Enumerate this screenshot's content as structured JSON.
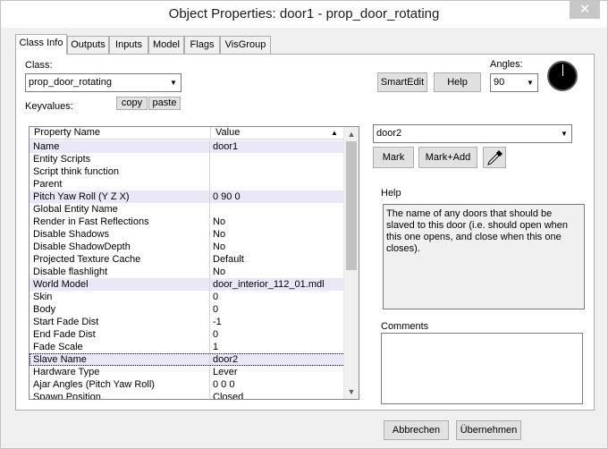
{
  "window": {
    "title": "Object Properties: door1 - prop_door_rotating",
    "close_glyph": "✕"
  },
  "tabs": [
    "Class Info",
    "Outputs",
    "Inputs",
    "Model",
    "Flags",
    "VisGroup"
  ],
  "class_section": {
    "class_label": "Class:",
    "class_value": "prop_door_rotating",
    "keyvalues_label": "Keyvalues:",
    "copy_label": "copy",
    "paste_label": "paste",
    "smartedit_label": "SmartEdit",
    "help_label": "Help",
    "angles_label": "Angles:",
    "angles_value": "90"
  },
  "grid": {
    "col_property": "Property Name",
    "col_value": "Value",
    "rows": [
      {
        "k": "Name",
        "v": "door1"
      },
      {
        "k": "Entity Scripts",
        "v": ""
      },
      {
        "k": "Script think function",
        "v": ""
      },
      {
        "k": "Parent",
        "v": ""
      },
      {
        "k": "Pitch Yaw Roll (Y Z X)",
        "v": "0 90 0"
      },
      {
        "k": "Global Entity Name",
        "v": ""
      },
      {
        "k": "Render in Fast Reflections",
        "v": "No"
      },
      {
        "k": "Disable Shadows",
        "v": "No"
      },
      {
        "k": "Disable ShadowDepth",
        "v": "No"
      },
      {
        "k": "Projected Texture Cache",
        "v": "Default"
      },
      {
        "k": "Disable flashlight",
        "v": "No"
      },
      {
        "k": "World Model",
        "v": "door_interior_112_01.mdl"
      },
      {
        "k": "Skin",
        "v": "0"
      },
      {
        "k": "Body",
        "v": "0"
      },
      {
        "k": "Start Fade Dist",
        "v": "-1"
      },
      {
        "k": "End Fade Dist",
        "v": "0"
      },
      {
        "k": "Fade Scale",
        "v": "1"
      },
      {
        "k": "Slave Name",
        "v": "door2"
      },
      {
        "k": "Hardware Type",
        "v": "Lever"
      },
      {
        "k": "Ajar Angles (Pitch Yaw Roll)",
        "v": "0 0 0"
      },
      {
        "k": "Spawn Position",
        "v": "Closed"
      }
    ]
  },
  "right_panel": {
    "value_combo": "door2",
    "mark_label": "Mark",
    "mark_add_label": "Mark+Add",
    "help_heading": "Help",
    "help_text": "The name of any doors that should be slaved to this door (i.e. should open when this one opens, and close when this one closes).",
    "comments_heading": "Comments"
  },
  "footer": {
    "cancel_label": "Abbrechen",
    "apply_label": "Übernehmen"
  }
}
